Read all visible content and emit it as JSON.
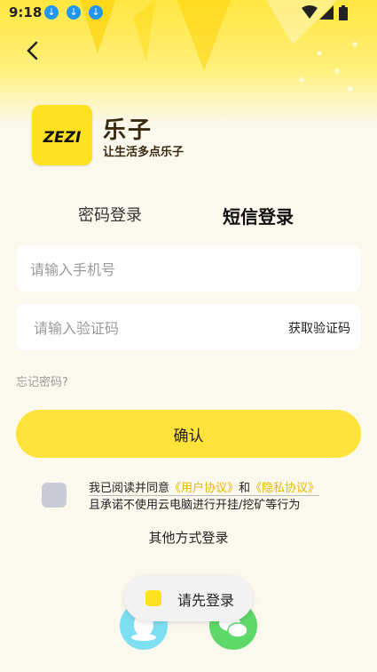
{
  "status_bar": {
    "time": "9:18"
  },
  "brand": {
    "name": "乐子",
    "slogan": "让生活多点乐子",
    "logo_text": "ZEZI"
  },
  "tabs": [
    {
      "label": "密码登录",
      "active": false
    },
    {
      "label": "短信登录",
      "active": true
    }
  ],
  "form": {
    "phone_placeholder": "请输入手机号",
    "code_placeholder": "请输入验证码",
    "get_code_label": "获取验证码",
    "forgot_label": "忘记密码?",
    "confirm_label": "确认"
  },
  "agreement": {
    "prefix": "我已阅读并同意",
    "user_link": "《用户协议》",
    "and": "和",
    "privacy_link": "《隐私协议》",
    "line2": "且承诺不使用云电脑进行开挂/挖矿等行为"
  },
  "other_login": {
    "label": "其他方式登录"
  },
  "toast": {
    "text": "请先登录"
  },
  "colors": {
    "accent": "#ffe23a",
    "link": "#e8b800",
    "background": "#fbf8ee"
  }
}
